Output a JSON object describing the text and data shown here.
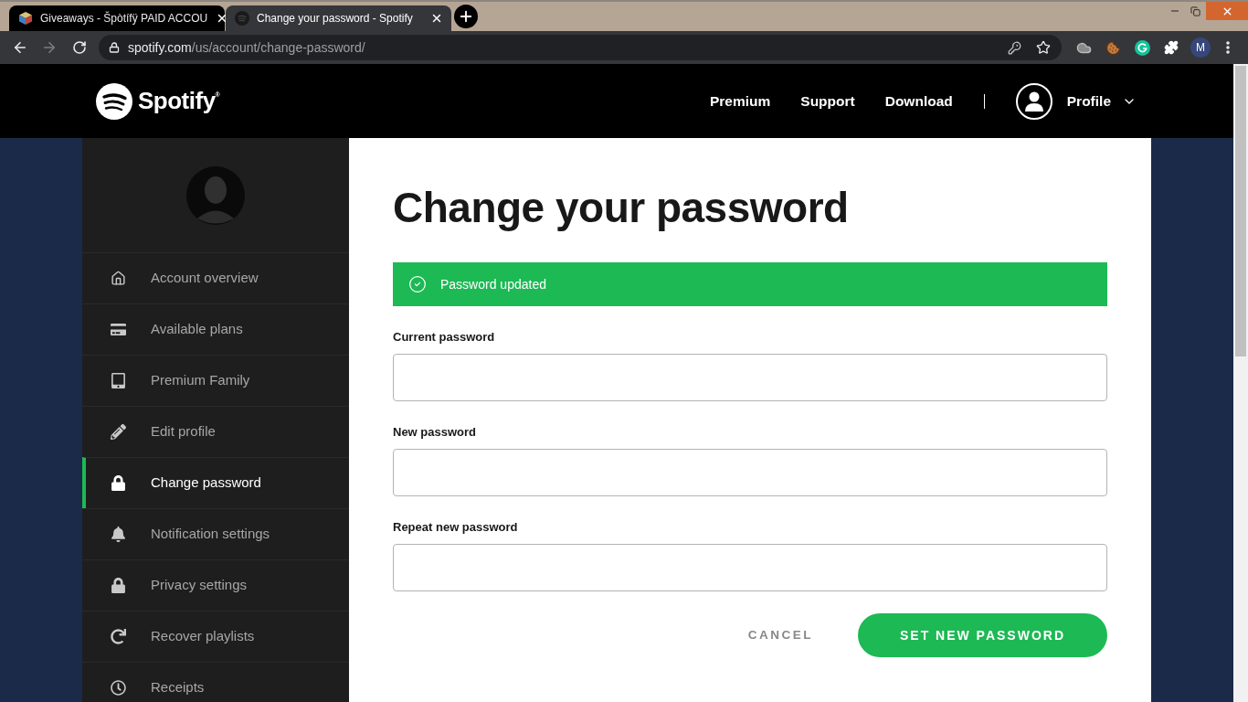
{
  "browser": {
    "tabs": [
      {
        "title": "Giveaways - Špòtífÿ PAID ACCOU",
        "selected": false
      },
      {
        "title": "Change your password - Spotify",
        "selected": true
      }
    ],
    "forward_button": {
      "disabled": true
    },
    "address_bar": {
      "domain": "spotify.com",
      "path": "/us/account/change-password/"
    },
    "profile_initial": "M"
  },
  "header": {
    "logo": "Spotify$^{®}$",
    "nav": [
      "Premium",
      "Support",
      "Download"
    ],
    "profile": "Profile"
  },
  "sidebar": {
    "items": [
      {
        "label": "Account overview",
        "selected": false
      },
      {
        "label": "Available plans",
        "selected": false
      },
      {
        "label": "Premium Family",
        "selected": false
      },
      {
        "label": "Edit profile",
        "selected": false
      },
      {
        "label": "Change password",
        "selected": true
      },
      {
        "label": "Notification settings",
        "selected": false
      },
      {
        "label": "Privacy settings",
        "selected": false
      },
      {
        "label": "Recover playlists",
        "selected": false
      },
      {
        "label": "Receipts",
        "selected": false
      }
    ]
  },
  "main": {
    "title": "Change your password",
    "alert": {
      "kind": "success",
      "text": "Password updated"
    },
    "fields": [
      {
        "label": "Current password"
      },
      {
        "label": "New password"
      },
      {
        "label": "Repeat new password"
      }
    ],
    "buttons": [
      {
        "kind": "secondary",
        "label": "CANCEL"
      },
      {
        "kind": "primary",
        "label": "SET NEW PASSWORD"
      }
    ]
  }
}
